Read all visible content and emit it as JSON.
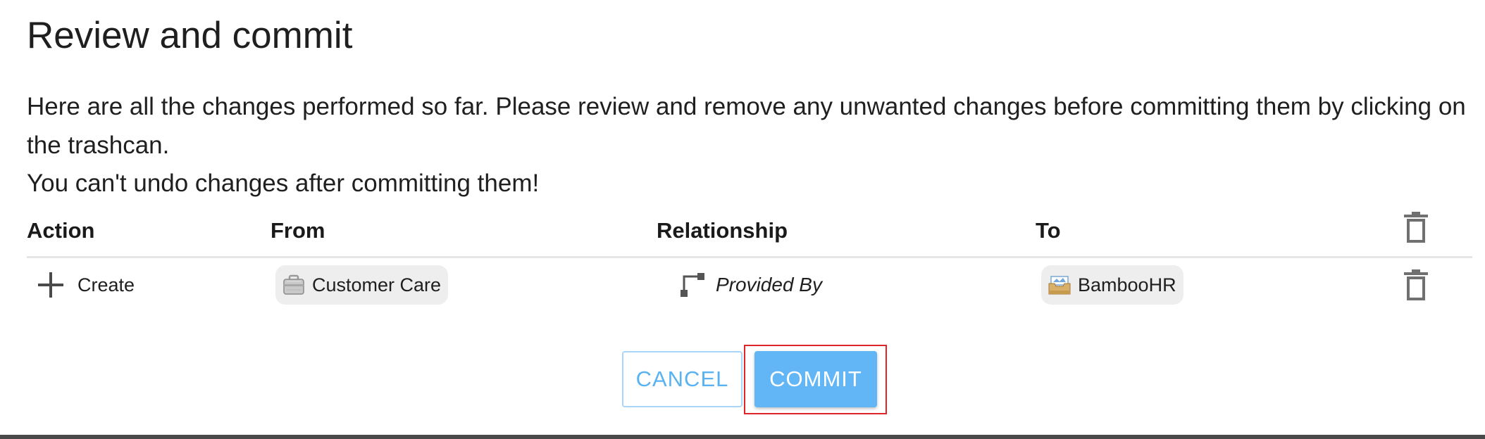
{
  "dialog": {
    "title": "Review and commit",
    "description": "Here are all the changes performed so far. Please review and remove any unwanted changes before committing them by clicking on the trashcan.",
    "warning": "You can't undo changes after committing them!"
  },
  "table": {
    "headers": {
      "action": "Action",
      "from": "From",
      "relationship": "Relationship",
      "to": "To",
      "delete_icon": "trash-icon"
    },
    "rows": [
      {
        "action": "Create",
        "action_icon": "plus-icon",
        "from": "Customer Care",
        "from_icon": "briefcase-icon",
        "relationship": "Provided By",
        "relationship_icon": "connector-icon",
        "to": "BambooHR",
        "to_icon": "inbox-tray-icon",
        "delete_icon": "trash-icon"
      }
    ]
  },
  "buttons": {
    "cancel": "CANCEL",
    "commit": "COMMIT"
  },
  "colors": {
    "accent": "#63b6f5",
    "highlight": "#e0252a",
    "chip_bg": "#eeeeee"
  }
}
